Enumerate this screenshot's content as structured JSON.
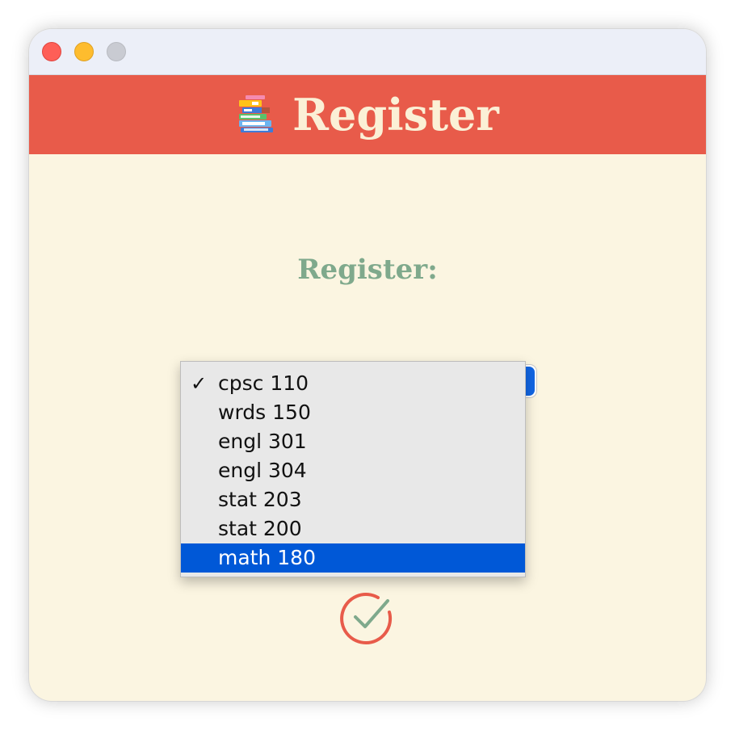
{
  "window": {
    "title": ""
  },
  "header": {
    "icon": "books-icon",
    "title": "Register"
  },
  "form": {
    "subtitle": "Register:",
    "course_select": {
      "selected_value": "cpsc 110",
      "highlighted_value": "math 180",
      "options": [
        "cpsc 110",
        "wrds 150",
        "engl 301",
        "engl 304",
        "stat 203",
        "stat 200",
        "math 180"
      ],
      "check_glyph": "✓"
    },
    "submit_icon": "check-circle-icon"
  },
  "colors": {
    "header_bg": "#E85B4A",
    "header_text": "#FBF0D6",
    "content_bg": "#FBF5E1",
    "subtitle": "#7FA98C",
    "highlight": "#0058D7",
    "check_circle": "#E85B4A",
    "check_mark": "#7FA98C"
  }
}
